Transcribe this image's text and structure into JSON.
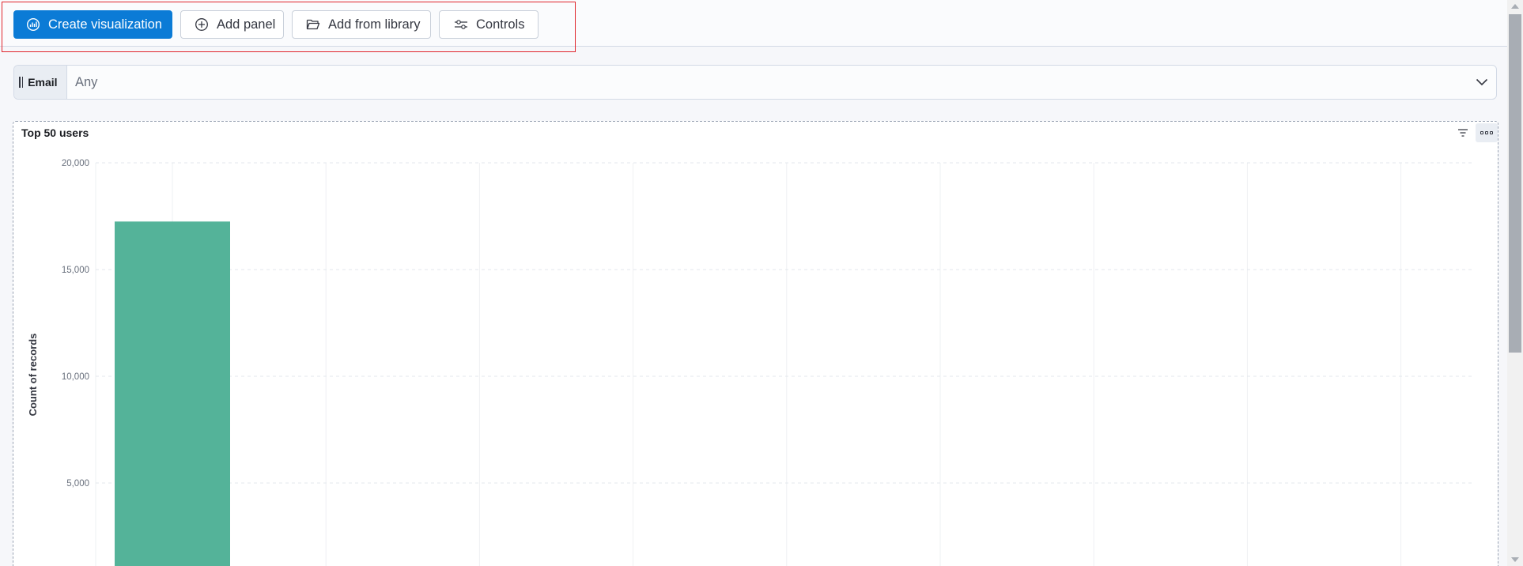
{
  "toolbar": {
    "create_label": "Create visualization",
    "add_panel_label": "Add panel",
    "add_library_label": "Add from library",
    "controls_label": "Controls"
  },
  "control": {
    "label": "Email",
    "value": "Any"
  },
  "panel": {
    "title": "Top 50 users"
  },
  "colors": {
    "primary": "#0b7bd6",
    "bar": "#54b399",
    "highlight": "#e0242b"
  },
  "chart_data": {
    "type": "bar",
    "title": "Top 50 users",
    "xlabel": "",
    "ylabel": "Count of records",
    "ylim": [
      0,
      20000
    ],
    "yticks": [
      "20,000",
      "15,000",
      "10,000",
      "5,000"
    ],
    "ytick_values": [
      20000,
      15000,
      10000,
      5000
    ],
    "categories": [
      ""
    ],
    "values": [
      17250
    ],
    "grid": true
  }
}
